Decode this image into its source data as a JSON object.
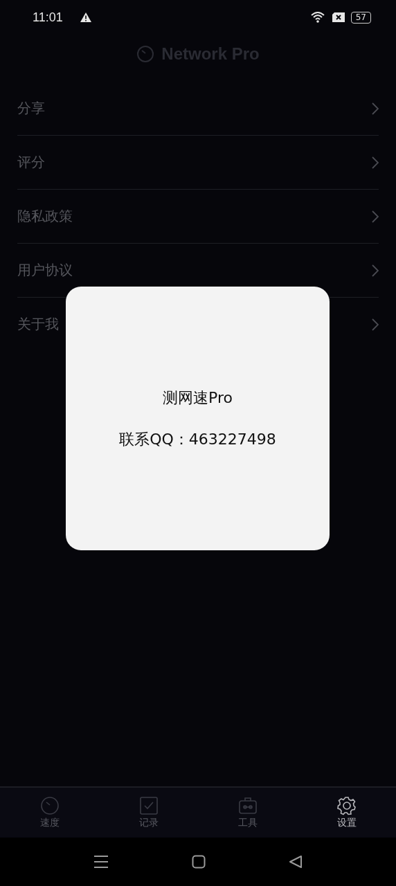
{
  "status_bar": {
    "time": "11:01",
    "battery": "57"
  },
  "header": {
    "title": "Network Pro"
  },
  "menu": [
    {
      "label": "分享"
    },
    {
      "label": "评分"
    },
    {
      "label": "隐私政策"
    },
    {
      "label": "用户协议"
    },
    {
      "label": "关于我"
    }
  ],
  "dialog": {
    "title": "测网速Pro",
    "contact": "联系QQ：463227498"
  },
  "tabs": [
    {
      "label": "速度",
      "kind": "speed",
      "selected": false
    },
    {
      "label": "记录",
      "kind": "record",
      "selected": false
    },
    {
      "label": "工具",
      "kind": "tools",
      "selected": false
    },
    {
      "label": "设置",
      "kind": "settings",
      "selected": true
    }
  ]
}
